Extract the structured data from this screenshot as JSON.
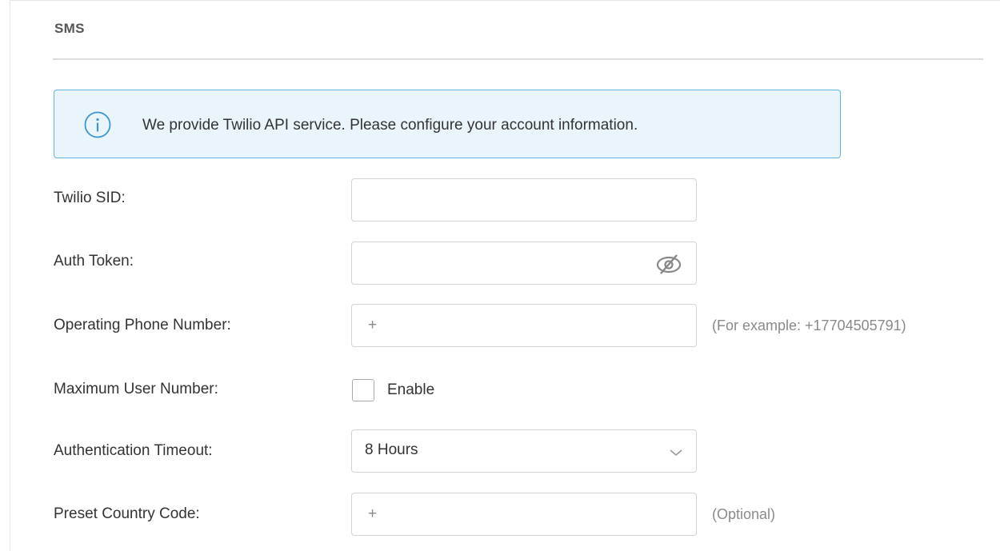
{
  "section": {
    "title": "SMS"
  },
  "notice": {
    "icon": "info-circle-icon",
    "text": "We provide Twilio API service. Please configure your account information.",
    "accent_color": "#5fb3e4",
    "background_color": "#eaf5fb"
  },
  "form": {
    "twilio_sid": {
      "label": "Twilio SID:",
      "value": ""
    },
    "auth_token": {
      "label": "Auth Token:",
      "value": "",
      "toggle_icon": "eye-slash-icon"
    },
    "operating_phone": {
      "label": "Operating Phone Number:",
      "prefix": "+",
      "value": "",
      "hint": "(For example: +17704505791)"
    },
    "max_user_number": {
      "label": "Maximum User Number:",
      "checkbox_label": "Enable",
      "checked": false
    },
    "auth_timeout": {
      "label": "Authentication Timeout:",
      "selected": "8 Hours",
      "icon": "chevron-down-icon"
    },
    "preset_country_code": {
      "label": "Preset Country Code:",
      "prefix": "+",
      "value": "",
      "hint": "(Optional)"
    }
  }
}
